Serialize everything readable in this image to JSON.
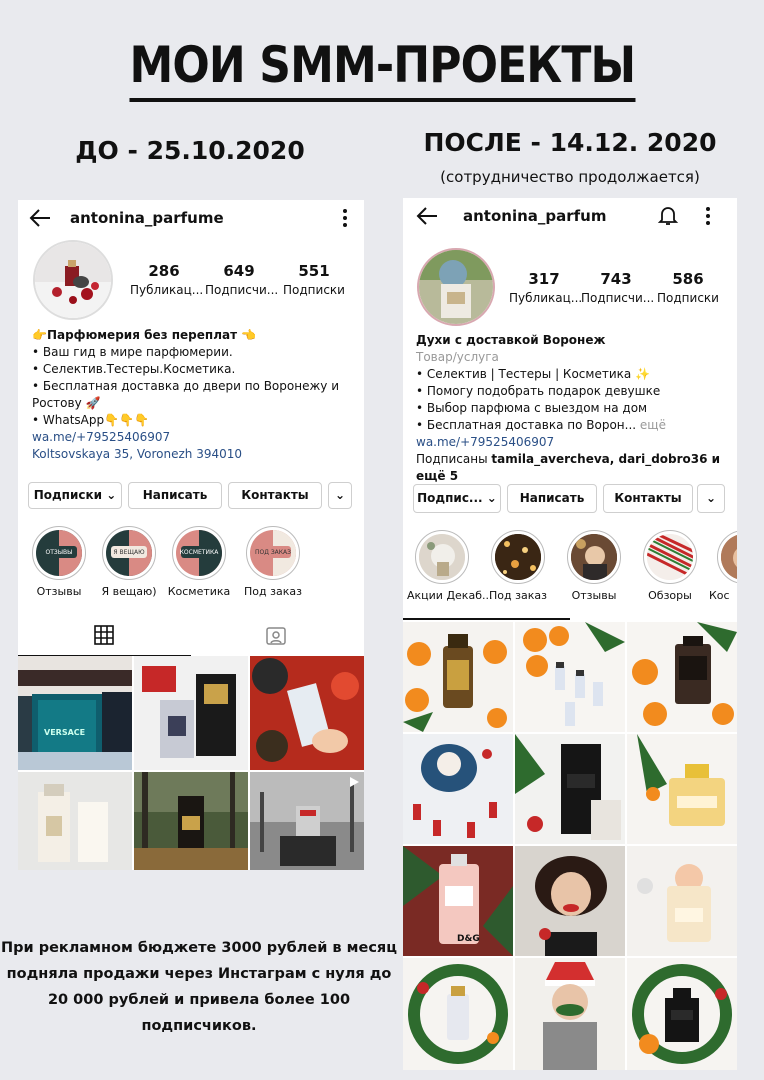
{
  "title": "МОИ SMM-ПРОЕКТЫ",
  "before": {
    "heading": "ДО - 25.10.2020",
    "username": "antonina_parfume",
    "stats": [
      {
        "num": "286",
        "label": "Публикац..."
      },
      {
        "num": "649",
        "label": "Подписчи..."
      },
      {
        "num": "551",
        "label": "Подписки"
      }
    ],
    "bio": {
      "line1": "👉Парфюмерия без переплат 👈",
      "line2": "• Ваш гид в мире парфюмерии.",
      "line3": "• Селектив.Тестеры.Косметика.",
      "line4": "• Бесплатная доставка до двери по Воронежу и Ростову 🚀",
      "line5": "• WhatsApp👇👇👇",
      "link": "wa.me/+79525406907",
      "address": "Koltsovskaya 35, Voronezh 394010"
    },
    "buttons": {
      "follow": "Подписки",
      "message": "Написать",
      "contacts": "Контакты"
    },
    "stories": [
      {
        "label": "Отзывы",
        "inner": "ОТЗЫВЫ"
      },
      {
        "label": "Я вещаю)",
        "inner": "Я ВЕЩАЮ"
      },
      {
        "label": "Косметика",
        "inner": "КОСМЕТИКА"
      },
      {
        "label": "Под заказ",
        "inner": "ПОД ЗАКАЗ"
      }
    ],
    "tile_texts": {
      "versace": "VERSACE"
    }
  },
  "after": {
    "heading": "ПОСЛЕ - 14.12. 2020",
    "subheading": "(сотрудничество продолжается)",
    "username": "antonina_parfum",
    "stats": [
      {
        "num": "317",
        "label": "Публикац..."
      },
      {
        "num": "743",
        "label": "Подписчи..."
      },
      {
        "num": "586",
        "label": "Подписки"
      }
    ],
    "bio": {
      "name": "Духи с доставкой Воронеж",
      "category": "Товар/услуга",
      "line1": "• Селектив | Тестеры | Косметика ✨",
      "line2": "• Помогу подобрать подарок девушке",
      "line3": "• Выбор парфюма с выездом на дом",
      "line4": "• Бесплатная доставка по Ворон...",
      "more": "ещё",
      "link": "wa.me/+79525406907",
      "followed_prefix": "Подписаны ",
      "followed_names": "tamila_avercheva, dari_dobro36",
      "followed_suffix": " и ещё 5"
    },
    "buttons": {
      "follow": "Подпис...",
      "message": "Написать",
      "contacts": "Контакты"
    },
    "stories": [
      {
        "label": "Акции Декаб..."
      },
      {
        "label": "Под заказ"
      },
      {
        "label": "Отзывы"
      },
      {
        "label": "Обзоры"
      },
      {
        "label": "Кос"
      }
    ],
    "tile_texts": {
      "dg": "D&G"
    }
  },
  "caption": "При рекламном бюджете 3000 рублей в месяц подняла продажи через Инстаграм с нуля до 20 000 рублей и привела более 100 подписчиков.",
  "colors": {
    "background": "#e9eaee",
    "link": "#2a4f86",
    "accent_pink": "#d98a84",
    "accent_dark": "#243c3c"
  }
}
